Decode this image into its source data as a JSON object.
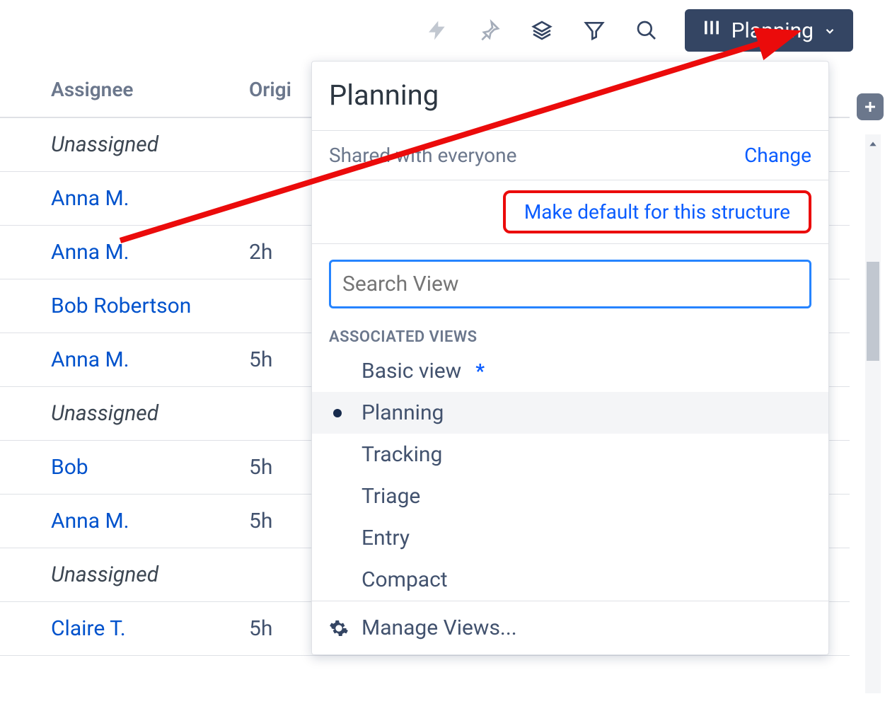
{
  "toolbar": {
    "view_button_label": "Planning"
  },
  "grid": {
    "columns": {
      "assignee": "Assignee",
      "origin": "Origi"
    },
    "rows": [
      {
        "assignee": "Unassigned",
        "unassigned": true,
        "origin": ""
      },
      {
        "assignee": "Anna M.",
        "unassigned": false,
        "origin": ""
      },
      {
        "assignee": "Anna M.",
        "unassigned": false,
        "origin": "2h"
      },
      {
        "assignee": "Bob Robertson",
        "unassigned": false,
        "origin": ""
      },
      {
        "assignee": "Anna M.",
        "unassigned": false,
        "origin": "5h"
      },
      {
        "assignee": "Unassigned",
        "unassigned": true,
        "origin": ""
      },
      {
        "assignee": "Bob",
        "unassigned": false,
        "origin": "5h"
      },
      {
        "assignee": "Anna M.",
        "unassigned": false,
        "origin": "5h"
      },
      {
        "assignee": "Unassigned",
        "unassigned": true,
        "origin": ""
      },
      {
        "assignee": "Claire T.",
        "unassigned": false,
        "origin": "5h"
      }
    ]
  },
  "panel": {
    "title": "Planning",
    "share_text": "Shared with everyone",
    "change_label": "Change",
    "make_default_label": "Make default for this structure",
    "search_placeholder": "Search View",
    "section_label": "ASSOCIATED VIEWS",
    "views": [
      {
        "label": "Basic view",
        "default": true,
        "selected": false
      },
      {
        "label": "Planning",
        "default": false,
        "selected": true
      },
      {
        "label": "Tracking",
        "default": false,
        "selected": false
      },
      {
        "label": "Triage",
        "default": false,
        "selected": false
      },
      {
        "label": "Entry",
        "default": false,
        "selected": false
      },
      {
        "label": "Compact",
        "default": false,
        "selected": false
      }
    ],
    "manage_label": "Manage Views..."
  },
  "colors": {
    "red": "#eb0b0b",
    "link": "#0a5cff",
    "toolbar_btn": "#344563"
  }
}
